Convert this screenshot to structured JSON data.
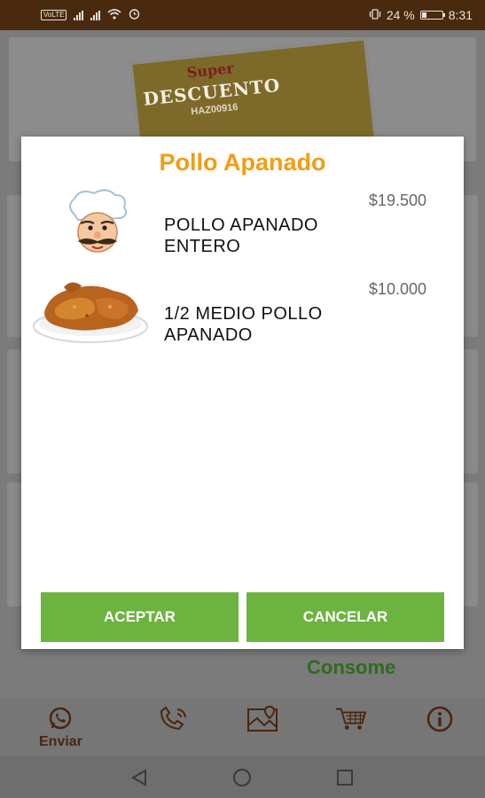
{
  "status_bar": {
    "volte": "VoLTE",
    "battery_percent": "24 %",
    "battery_level": 0.24,
    "time": "8:31"
  },
  "background": {
    "banner_line1": "Super",
    "banner_line2": "DESCUENTO",
    "banner_code": "HAZ00916",
    "next_section_title": "Consome"
  },
  "bottom_nav": {
    "items": [
      {
        "label": "Enviar",
        "icon": "whatsapp-icon"
      },
      {
        "label": "",
        "icon": "phone-icon"
      },
      {
        "label": "",
        "icon": "map-icon"
      },
      {
        "label": "",
        "icon": "cart-icon"
      },
      {
        "label": "",
        "icon": "info-icon"
      }
    ]
  },
  "dialog": {
    "title": "Pollo Apanado",
    "items": [
      {
        "price": "$19.500",
        "name": "POLLO APANADO ENTERO",
        "image": "chef-mascot-image"
      },
      {
        "price": "$10.000",
        "name": "1/2 MEDIO POLLO APANADO",
        "image": "fried-chicken-image"
      }
    ],
    "accept_label": "ACEPTAR",
    "cancel_label": "CANCELAR"
  },
  "colors": {
    "status_bar": "#4a2a0e",
    "title": "#f39c12",
    "button": "#6db33f",
    "nav_accent": "#4a2610"
  }
}
